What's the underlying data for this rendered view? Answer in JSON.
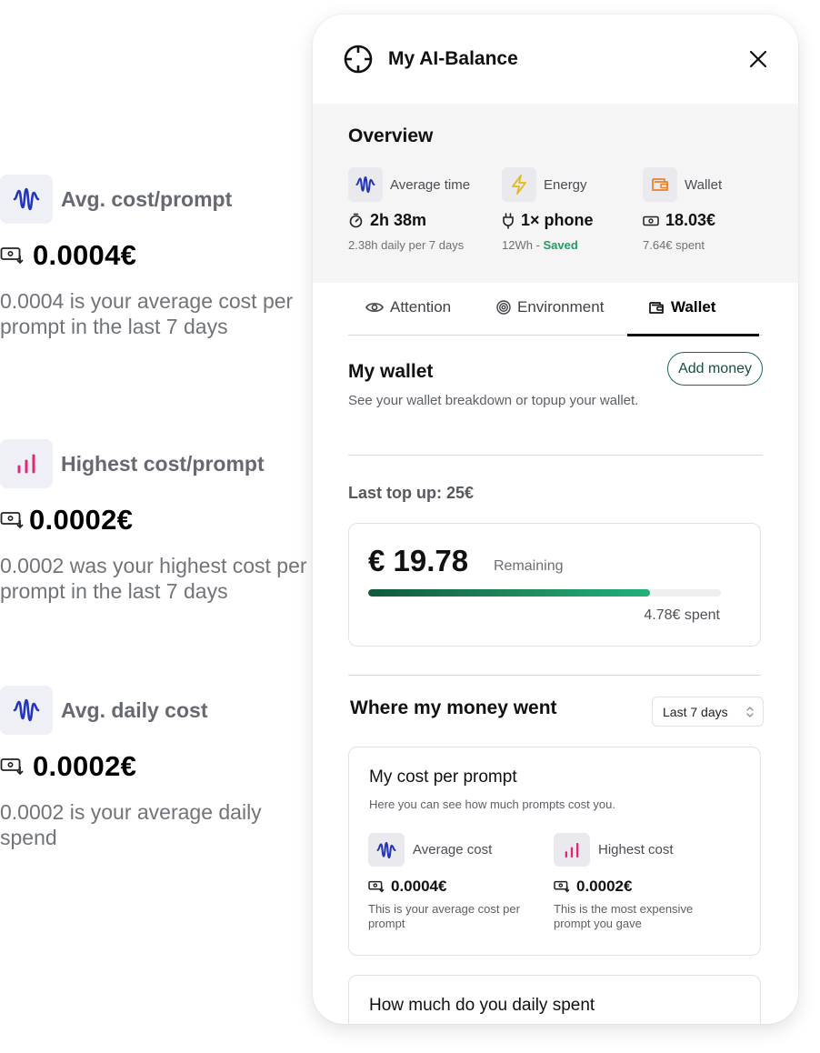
{
  "left_stats": [
    {
      "title": "Avg. cost/prompt",
      "value": "0.0004€",
      "description": "0.0004 is your average cost per prompt in the last 7 days",
      "icon": "waveform-icon"
    },
    {
      "title": "Highest cost/prompt",
      "value": "0.0002€",
      "description": "0.0002 was your highest cost per prompt in the last 7 days",
      "icon": "bar-chart-icon"
    },
    {
      "title": "Avg. daily cost",
      "value": "0.0002€",
      "description": "0.0002 is your average daily spend",
      "icon": "waveform-icon"
    }
  ],
  "panel": {
    "title": "My AI-Balance",
    "overview": {
      "title": "Overview",
      "cards": [
        {
          "label": "Average time",
          "value": "2h 38m",
          "sub": "2.38h daily per 7 days"
        },
        {
          "label": "Energy",
          "value": "1× phone",
          "sub": "12Wh - ",
          "sub_status": "Saved"
        },
        {
          "label": "Wallet",
          "value": "18.03€",
          "sub": "7.64€ spent"
        }
      ]
    },
    "tabs": [
      {
        "label": "Attention"
      },
      {
        "label": "Environment"
      },
      {
        "label": "Wallet",
        "active": true
      }
    ],
    "wallet": {
      "title": "My wallet",
      "description": "See your wallet breakdown or topup your wallet.",
      "add_button": "Add money",
      "last_topup": "Last top up: 25€",
      "remaining_amount": "€ 19.78",
      "remaining_label": "Remaining",
      "remaining_fraction": 0.8,
      "spent": "4.78€ spent"
    },
    "where_money_went": {
      "title": "Where my money went",
      "period": "Last 7 days"
    },
    "cost_per_prompt": {
      "title": "My cost per prompt",
      "description": "Here you can see how much prompts cost you.",
      "items": [
        {
          "label": "Average cost",
          "value": "0.0004€",
          "note": "This is your average cost per prompt"
        },
        {
          "label": "Highest cost",
          "value": "0.0002€",
          "note": "This is the most expensive prompt you gave"
        }
      ]
    },
    "daily_spent": {
      "title": "How much do you daily spent"
    }
  },
  "colors": {
    "accent_blue": "#2336b8",
    "accent_pink": "#e0287a",
    "accent_yellow": "#e4b81c",
    "accent_orange": "#e8832a",
    "accent_green": "#1f9d63"
  }
}
